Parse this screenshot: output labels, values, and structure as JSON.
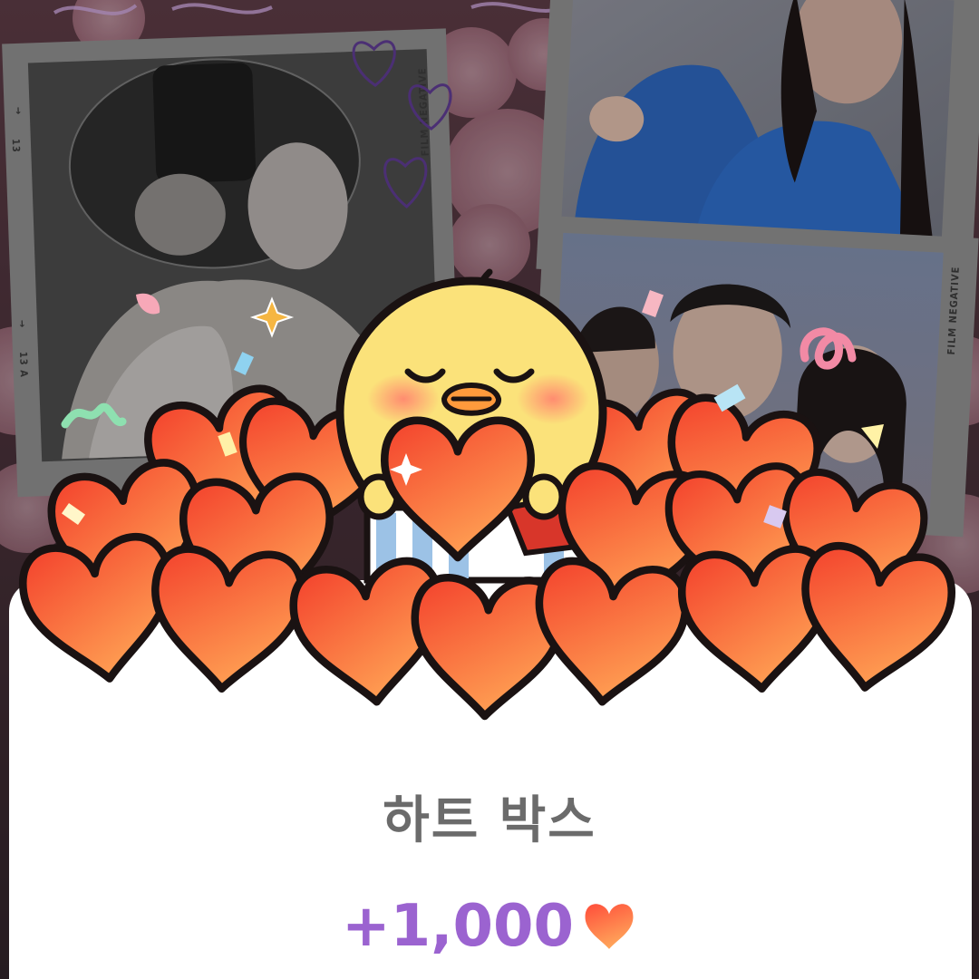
{
  "popup": {
    "title": "하트 박스",
    "amount": "+1,000"
  },
  "film": {
    "caption_left": "FILM NEGATIVE",
    "caption_right": "FILM NEGATIVE",
    "frame_13": "13",
    "frame_13a": "13 A",
    "arrow": "→"
  },
  "colors": {
    "amount": "#9b63d0",
    "title": "#6b6b6b",
    "heart_light": "#ff9a52",
    "heart_dark": "#f2402b",
    "outline": "#1a1212",
    "chick": "#fbe27a"
  },
  "icons": [
    "heart-icon",
    "chick-mascot",
    "confetti",
    "sparkle-icon"
  ]
}
